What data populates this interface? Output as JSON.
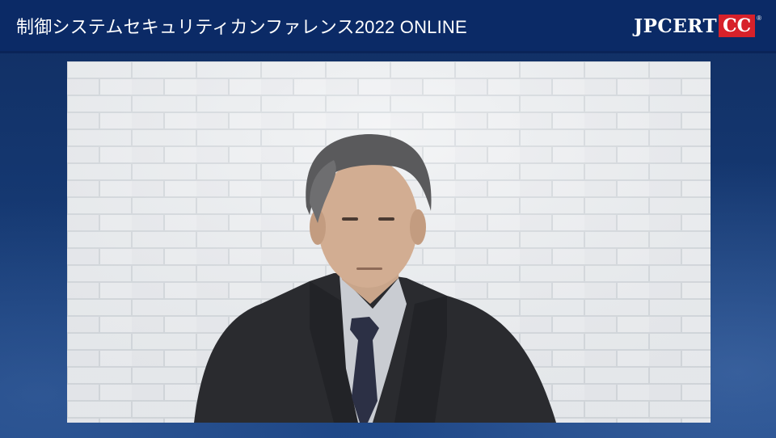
{
  "header": {
    "title": "制御システムセキュリティカンファレンス2022 ONLINE",
    "logo_text": "JPCERT",
    "logo_badge": "CC",
    "logo_mark": "®"
  },
  "video": {
    "content": "speaker-video"
  },
  "colors": {
    "header_bg": "#0b2a66",
    "background": "#163a74",
    "logo_red": "#d7212a",
    "wall": "#e9ecef"
  }
}
